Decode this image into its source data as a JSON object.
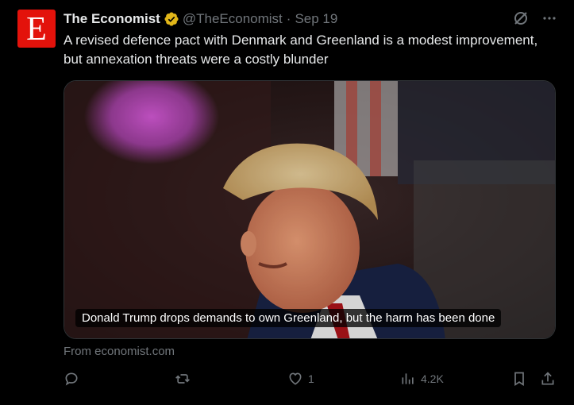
{
  "tweet": {
    "avatar_letter": "E",
    "author_name": "The Economist",
    "handle": "@TheEconomist",
    "separator": "·",
    "date": "Sep 19",
    "text": "A revised defence pact with Denmark and Greenland is a modest improvement, but annexation threats were a costly blunder",
    "card_caption": "Donald Trump drops demands to own Greenland, but the harm has been done",
    "source": "From economist.com"
  },
  "actions": {
    "reply_count": "",
    "retweet_count": "",
    "like_count": "1",
    "view_count": "4.2K"
  },
  "icons": [
    "grok-icon",
    "more-icon",
    "reply-icon",
    "retweet-icon",
    "like-icon",
    "views-icon",
    "bookmark-icon",
    "share-icon",
    "verified-badge-icon"
  ],
  "colors": {
    "background": "#000000",
    "text": "#e7e9ea",
    "muted": "#71767b",
    "brand": "#e3120b",
    "verified": "#e2b719"
  }
}
